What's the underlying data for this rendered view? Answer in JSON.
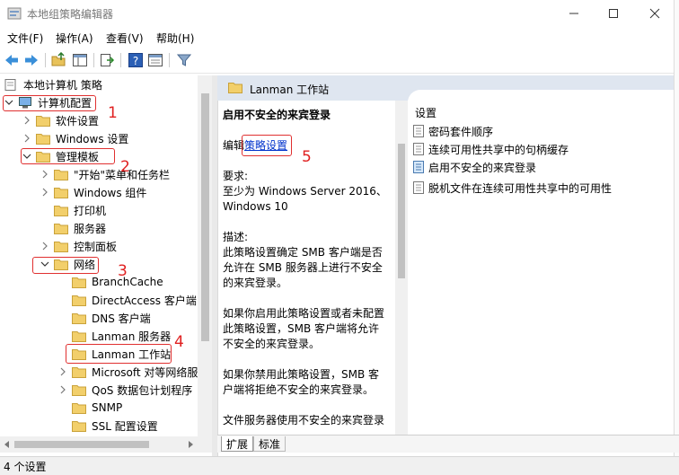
{
  "window": {
    "title": "本地组策略编辑器",
    "minimize_label": "—",
    "maximize_label": "☐",
    "close_label": "✕"
  },
  "menu": [
    "文件(F)",
    "操作(A)",
    "查看(V)",
    "帮助(H)"
  ],
  "toolbar": {
    "icons": [
      "back-icon",
      "forward-icon",
      "up-folder-icon",
      "show-hide-tree-icon",
      "export-list-icon",
      "help-icon",
      "properties-view-icon",
      "filter-icon"
    ]
  },
  "tree": {
    "root": "本地计算机 策略",
    "computer_config": "计算机配置",
    "software_settings": "软件设置",
    "windows_settings": "Windows 设置",
    "admin_templates": "管理模板",
    "start_menu": "\"开始\"菜单和任务栏",
    "windows_components": "Windows 组件",
    "printers": "打印机",
    "server": "服务器",
    "control_panel": "控制面板",
    "network": "网络",
    "branchcache": "BranchCache",
    "directaccess": "DirectAccess 客户端",
    "dns_client": "DNS 客户端",
    "lanman_server": "Lanman 服务器",
    "lanman_workstation": "Lanman 工作站",
    "microsoft_p2p": "Microsoft 对等网络服",
    "qos": "QoS 数据包计划程序",
    "snmp": "SNMP",
    "ssl": "SSL 配置设置"
  },
  "right": {
    "header_title": "Lanman 工作站",
    "desc_title": "启用不安全的来宾登录",
    "edit_prefix": "编辑",
    "edit_link": "策略设置",
    "req_label": "要求:",
    "req_text": "至少为 Windows Server 2016、Windows 10",
    "desc_label": "描述:",
    "desc_p1": "此策略设置确定 SMB 客户端是否允许在 SMB 服务器上进行不安全的来宾登录。",
    "desc_p2": "如果你启用此策略设置或者未配置此策略设置，SMB 客户端将允许不安全的来宾登录。",
    "desc_p3": "如果你禁用此策略设置，SMB 客户端将拒绝不安全的来宾登录。",
    "desc_p4": "文件服务器使用不安全的来宾登录",
    "settings_header": "设置",
    "settings": [
      "密码套件顺序",
      "连续可用性共享中的句柄缓存",
      "启用不安全的来宾登录",
      "脱机文件在连续可用性共享中的可用性"
    ],
    "tab_expand": "扩展",
    "tab_standard": "标准"
  },
  "status": "4 个设置",
  "annotations": [
    "1",
    "2",
    "3",
    "4",
    "5"
  ],
  "colors": {
    "annotation_red": "#e03030",
    "folder_yellow": "#e8c25a",
    "link_blue": "#0033cc",
    "header_bg": "#dfe6f0"
  }
}
